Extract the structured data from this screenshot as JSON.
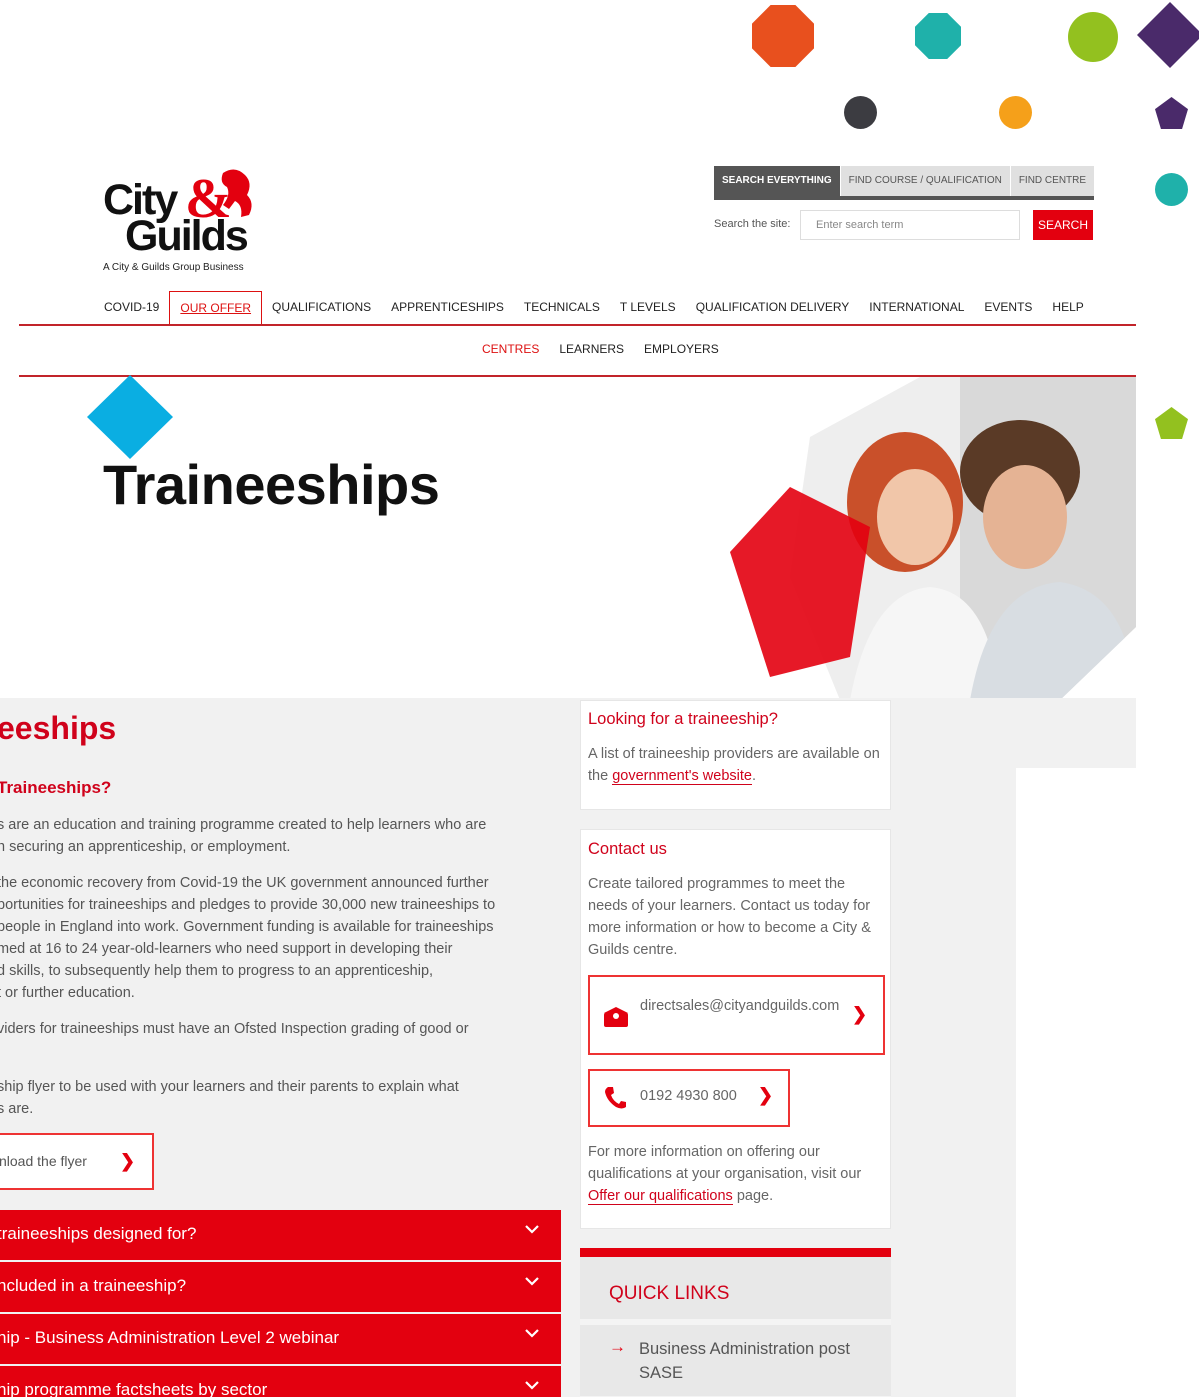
{
  "logo": {
    "line1": "City",
    "line2": "Guilds",
    "tagline": "A City & Guilds Group Business"
  },
  "search": {
    "tabs": [
      "SEARCH EVERYTHING",
      "FIND COURSE / QUALIFICATION",
      "FIND CENTRE"
    ],
    "label": "Search the site:",
    "placeholder": "Enter search term",
    "button": "SEARCH"
  },
  "nav": {
    "items": [
      "COVID-19",
      "OUR OFFER",
      "QUALIFICATIONS",
      "APPRENTICESHIPS",
      "TECHNICALS",
      "T LEVELS",
      "QUALIFICATION DELIVERY",
      "INTERNATIONAL",
      "EVENTS",
      "HELP"
    ],
    "active": "OUR OFFER",
    "sub_items": [
      "CENTRES",
      "LEARNERS",
      "EMPLOYERS"
    ],
    "sub_active": "CENTRES"
  },
  "hero": {
    "title": "Traineeships"
  },
  "article": {
    "heading": "eeships",
    "subheading": "Traineeships?",
    "paragraphs": [
      [
        "s are an education and training programme created to help learners who are",
        "n securing an apprenticeship, or employment."
      ],
      [
        "the economic recovery from Covid-19 the UK government announced further",
        "portunities for traineeships and pledges to provide 30,000 new traineeships to",
        "people in England into work. Government funding is available for traineeships",
        "med at 16 to 24 year-old-learners who need support in developing their",
        "d skills, to subsequently help them to progress to an apprenticeship,",
        "t or further education."
      ],
      [
        "viders for traineeships must have an Ofsted Inspection grading of good or",
        "."
      ],
      [
        "ship flyer to be used with your learners and their parents to explain what",
        "s are."
      ]
    ],
    "flyer_button": "nload the flyer",
    "accordions": [
      "traineeships designed for?",
      "ncluded in a traineeship?",
      "hip - Business Administration Level 2 webinar",
      "hip programme factsheets by sector"
    ]
  },
  "sidebar": {
    "looking": {
      "title": "Looking for a traineeship?",
      "text_before": "A list of traineeship providers are available on the ",
      "link": "government's website",
      "text_after": "."
    },
    "contact": {
      "title": "Contact us",
      "intro": "Create tailored programmes to meet the needs of your learners. Contact us today for more information or how to become a City & Guilds centre.",
      "email": "directsales@cityandguilds.com",
      "phone": "0192 4930 800",
      "more_before": "For more information on offering our qualifications at your organisation, visit our ",
      "more_link": "Offer our qualifications",
      "more_after": " page."
    },
    "quick_links": {
      "title": "QUICK LINKS",
      "items": [
        "Business Administration post SASE"
      ]
    }
  },
  "colors": {
    "brand_red": "#e3000f",
    "heading_red": "#d0021b",
    "hero_diamond": "#0aaee2"
  }
}
